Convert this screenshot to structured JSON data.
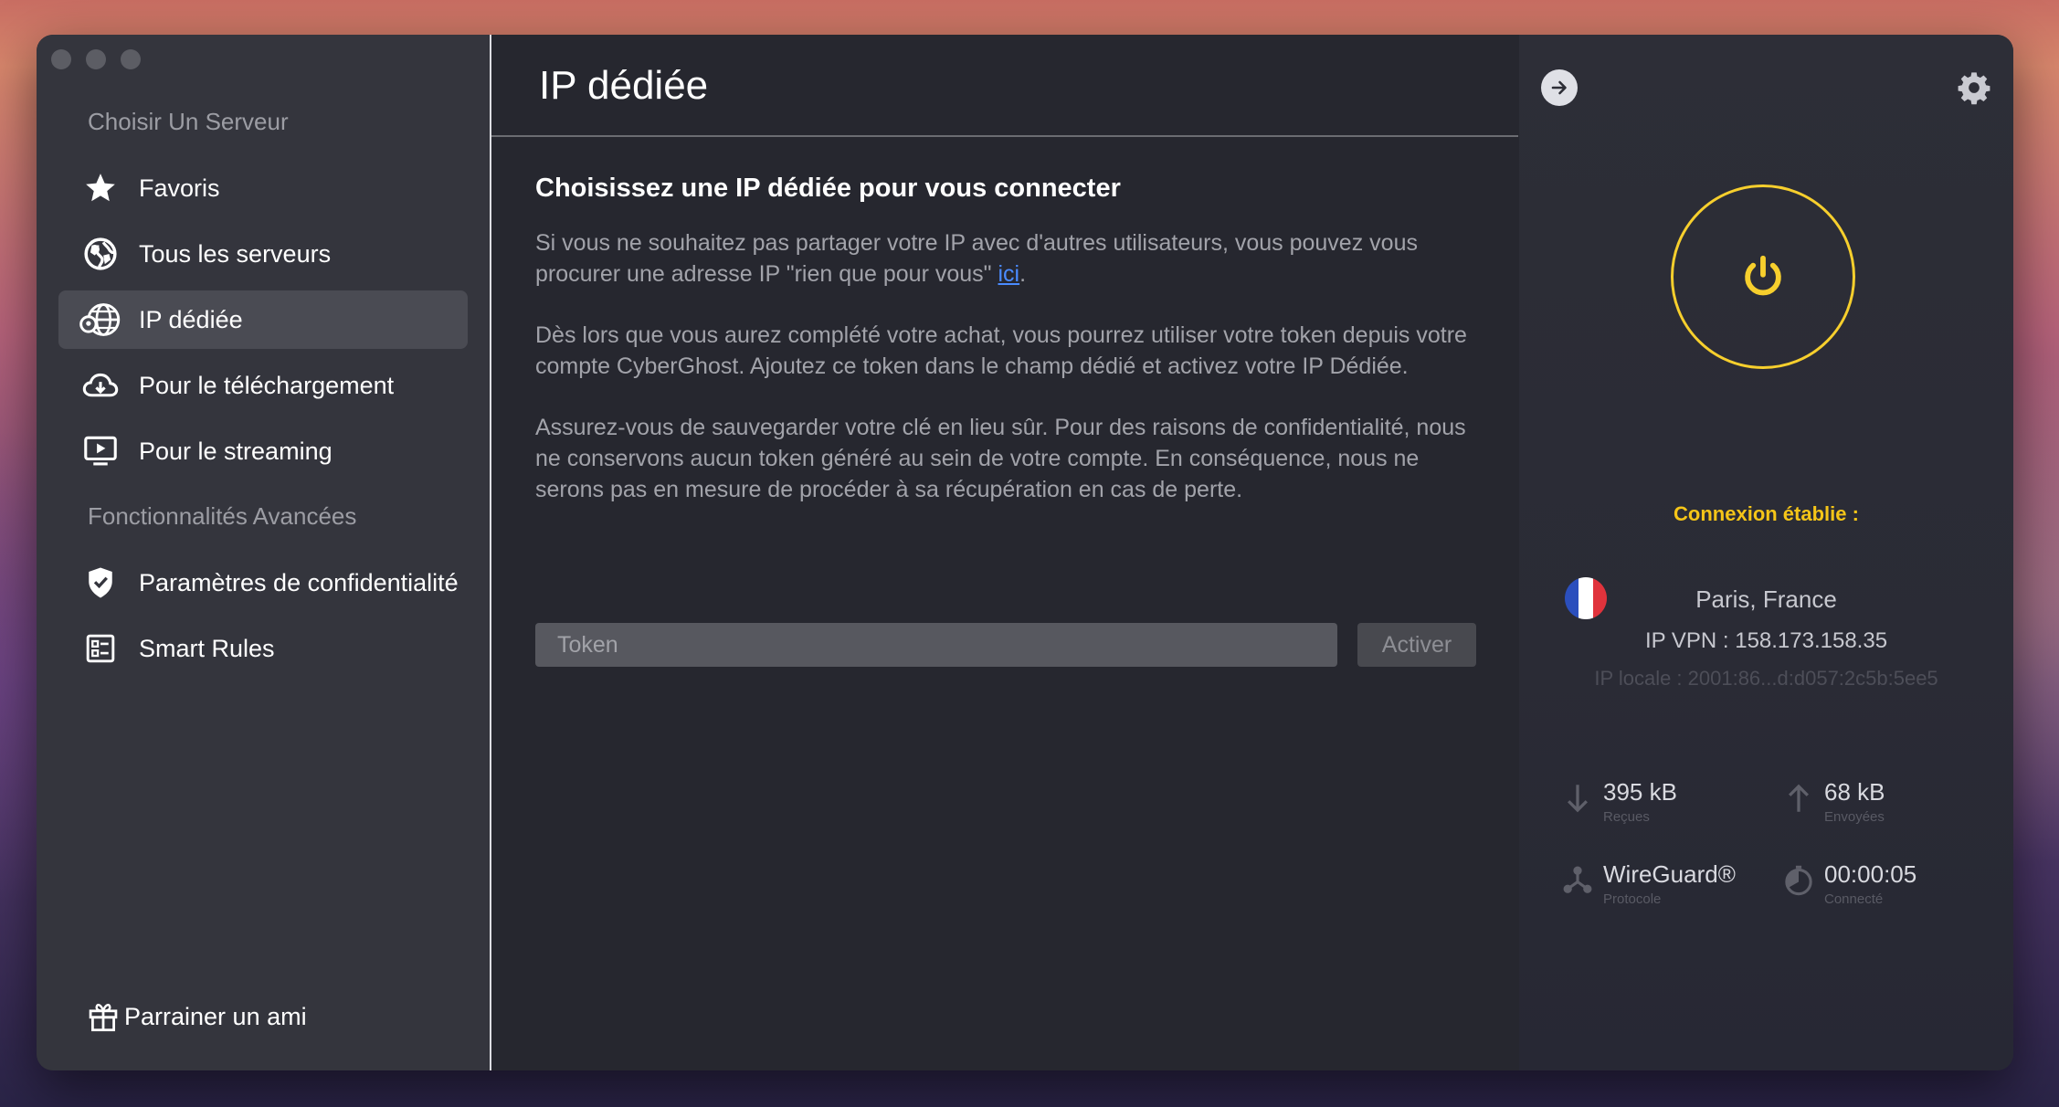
{
  "sidebar": {
    "section_servers": "Choisir Un Serveur",
    "items": [
      {
        "label": "Favoris",
        "icon": "star-icon"
      },
      {
        "label": "Tous les serveurs",
        "icon": "globe-icon"
      },
      {
        "label": "IP dédiée",
        "icon": "dedicated-ip-globe-icon",
        "active": true
      },
      {
        "label": "Pour le téléchargement",
        "icon": "cloud-download-icon"
      },
      {
        "label": "Pour le streaming",
        "icon": "screen-play-icon"
      }
    ],
    "section_advanced": "Fonctionnalités Avancées",
    "advanced_items": [
      {
        "label": "Paramètres de confidentialité",
        "icon": "shield-check-icon"
      },
      {
        "label": "Smart Rules",
        "icon": "rules-list-icon"
      }
    ],
    "refer_label": "Parrainer un ami"
  },
  "main": {
    "title": "IP dédiée",
    "heading": "Choisissez une IP dédiée pour vous connecter",
    "para1_before": "Si vous ne souhaitez pas partager votre IP avec d'autres utilisateurs, vous pouvez vous procurer une adresse IP \"rien que pour vous\" ",
    "para1_link": "ici",
    "para1_after": ".",
    "para2": "Dès lors que vous aurez complété votre achat, vous pourrez utiliser votre token depuis votre compte CyberGhost. Ajoutez ce token dans le champ dédié et activez votre IP Dédiée.",
    "para3": "Assurez-vous de sauvegarder votre clé en lieu sûr. Pour des raisons de confidentialité, nous ne conservons aucun token généré au sein de votre compte. En conséquence, nous ne serons pas en mesure de procéder à sa récupération en cas de perte.",
    "token_placeholder": "Token",
    "token_value": "",
    "activate_label": "Activer"
  },
  "panel": {
    "status": "Connexion établie :",
    "location": "Paris, France",
    "vpn_ip": "IP VPN : 158.173.158.35",
    "local_ip": "IP locale : 2001:86...d:d057:2c5b:5ee5",
    "received_value": "395 kB",
    "received_label": "Reçues",
    "sent_value": "68 kB",
    "sent_label": "Envoyées",
    "protocol_value": "WireGuard®",
    "protocol_label": "Protocole",
    "time_value": "00:00:05",
    "time_label": "Connecté"
  },
  "colors": {
    "accent_yellow": "#f7cf2d",
    "link_blue": "#4a8bff",
    "sidebar_bg": "#34353d",
    "main_bg": "#26272f"
  }
}
